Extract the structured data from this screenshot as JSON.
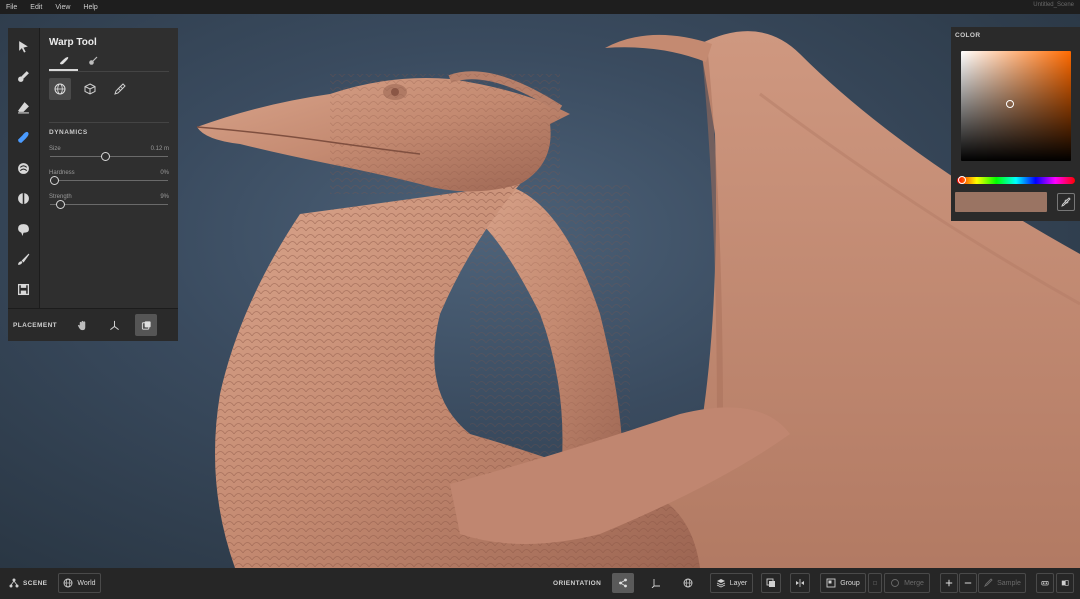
{
  "menu": {
    "items": [
      "File",
      "Edit",
      "View",
      "Help"
    ],
    "doc_title": "Untitled_Scene"
  },
  "tools": [
    {
      "icon": "select-arrow-icon",
      "active": false
    },
    {
      "icon": "clay-brush-icon",
      "active": false
    },
    {
      "icon": "eraser-icon",
      "active": false
    },
    {
      "icon": "warp-tool-icon",
      "active": true
    },
    {
      "icon": "smooth-tool-icon",
      "active": false
    },
    {
      "icon": "flatten-tool-icon",
      "active": false
    },
    {
      "icon": "inflate-tool-icon",
      "active": false
    },
    {
      "icon": "paint-brush-icon",
      "active": false
    },
    {
      "icon": "save-icon",
      "active": false
    }
  ],
  "tool_panel": {
    "title": "Warp Tool",
    "dynamics_label": "DYNAMICS",
    "sliders": [
      {
        "label": "Size",
        "value": "0.12 m",
        "fraction": 0.47
      },
      {
        "label": "Hardness",
        "value": "0%",
        "fraction": 0.0
      },
      {
        "label": "Strength",
        "value": "9%",
        "fraction": 0.09
      }
    ]
  },
  "placement": {
    "label": "PLACEMENT"
  },
  "color_panel": {
    "title": "COLOR",
    "hue_color": "#ff6a00",
    "swatch_color": "#9a7463"
  },
  "bottom_bar": {
    "scene_label": "SCENE",
    "world_label": "World",
    "orientation_label": "ORIENTATION",
    "layer_label": "Layer",
    "group_label": "Group",
    "merge_label": "Merge",
    "sample_label": "Sample"
  },
  "colors": {
    "accent": "#4a9bff",
    "clay": "#c98f77",
    "background": "#3a4b5f"
  }
}
